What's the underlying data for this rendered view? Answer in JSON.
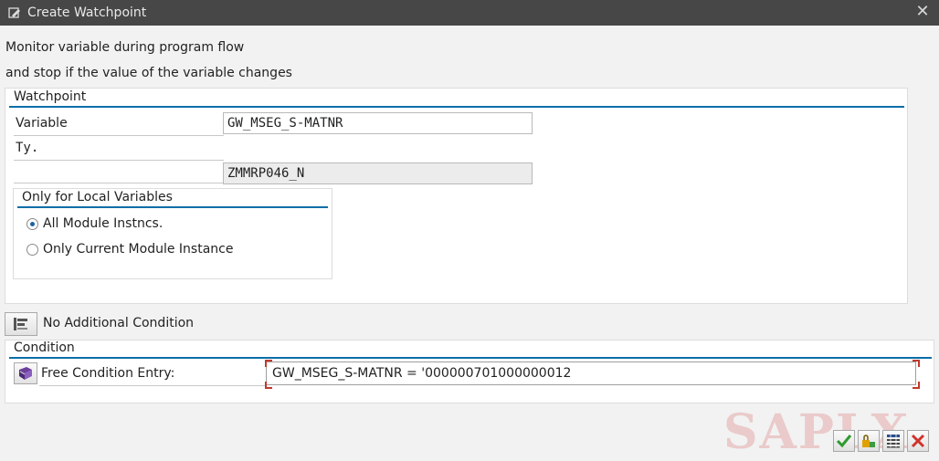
{
  "window": {
    "title": "Create Watchpoint"
  },
  "intro": {
    "line1": "Monitor variable during program flow",
    "line2": "and stop if the value of the variable changes"
  },
  "watchpoint": {
    "group_title": "Watchpoint",
    "variable_label": "Variable",
    "variable_value": "GW_MSEG_S-MATNR",
    "type_label": "Ty.",
    "program_value": "ZMMRP046_N",
    "local_group_title": "Only for Local Variables",
    "radio_all": "All Module Instncs.",
    "radio_current": "Only Current Module Instance",
    "selected_radio": "radio_all"
  },
  "condition": {
    "toggle_label": "No Additional Condition",
    "group_title": "Condition",
    "free_entry_label": "Free Condition Entry:",
    "free_entry_value": "GW_MSEG_S-MATNR = '000000701000000012"
  },
  "watermark": "SAPLX",
  "colors": {
    "titlebar": "#474747",
    "section_underline": "#0a6ea8",
    "confirm": "#2e9b2e",
    "cancel": "#d0332b"
  }
}
